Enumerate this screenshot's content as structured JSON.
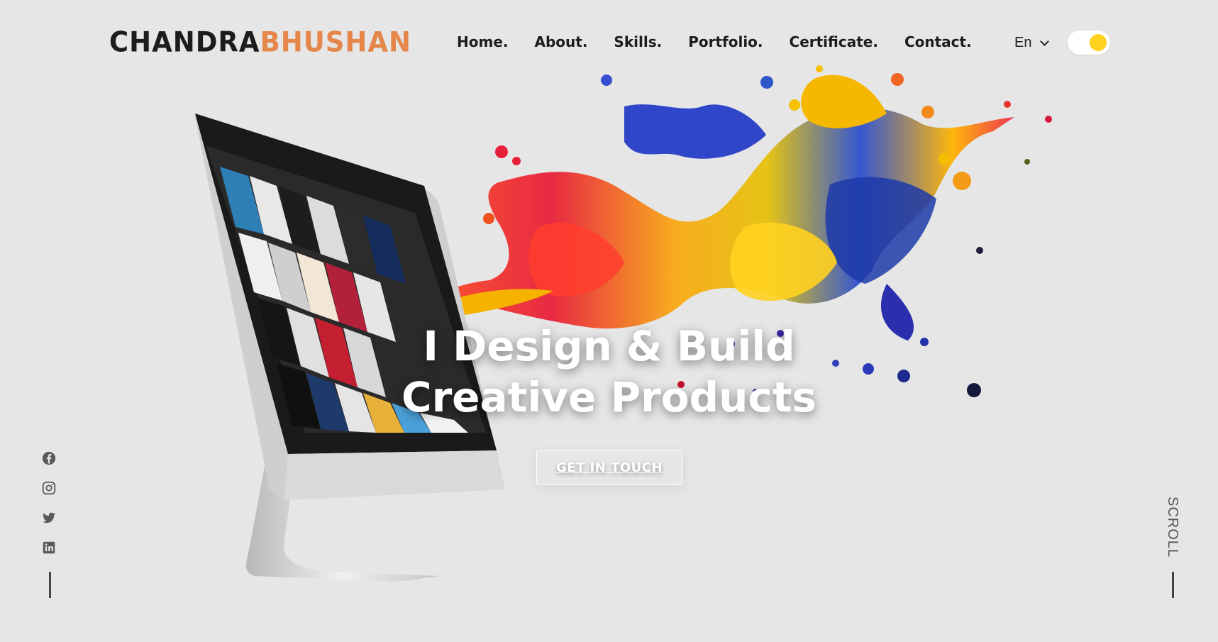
{
  "brand": {
    "first": "CHANDRA",
    "last": "BHUSHAN",
    "accent_color": "#e5874a"
  },
  "nav": {
    "items": [
      {
        "label": "Home."
      },
      {
        "label": "About."
      },
      {
        "label": "Skills."
      },
      {
        "label": "Portfolio."
      },
      {
        "label": "Certificate."
      },
      {
        "label": "Contact."
      }
    ]
  },
  "language": {
    "selected": "En",
    "icon": "chevron-down-icon"
  },
  "theme_toggle": {
    "state": "on",
    "knob_color": "#ffd21f"
  },
  "hero": {
    "title_line1": "I Design & Build",
    "title_line2": "Creative Products",
    "cta_label": "GET IN TOUCH"
  },
  "social": [
    {
      "icon": "facebook-icon"
    },
    {
      "icon": "instagram-icon"
    },
    {
      "icon": "twitter-icon"
    },
    {
      "icon": "linkedin-icon"
    }
  ],
  "scroll": {
    "label": "SCROLL"
  }
}
